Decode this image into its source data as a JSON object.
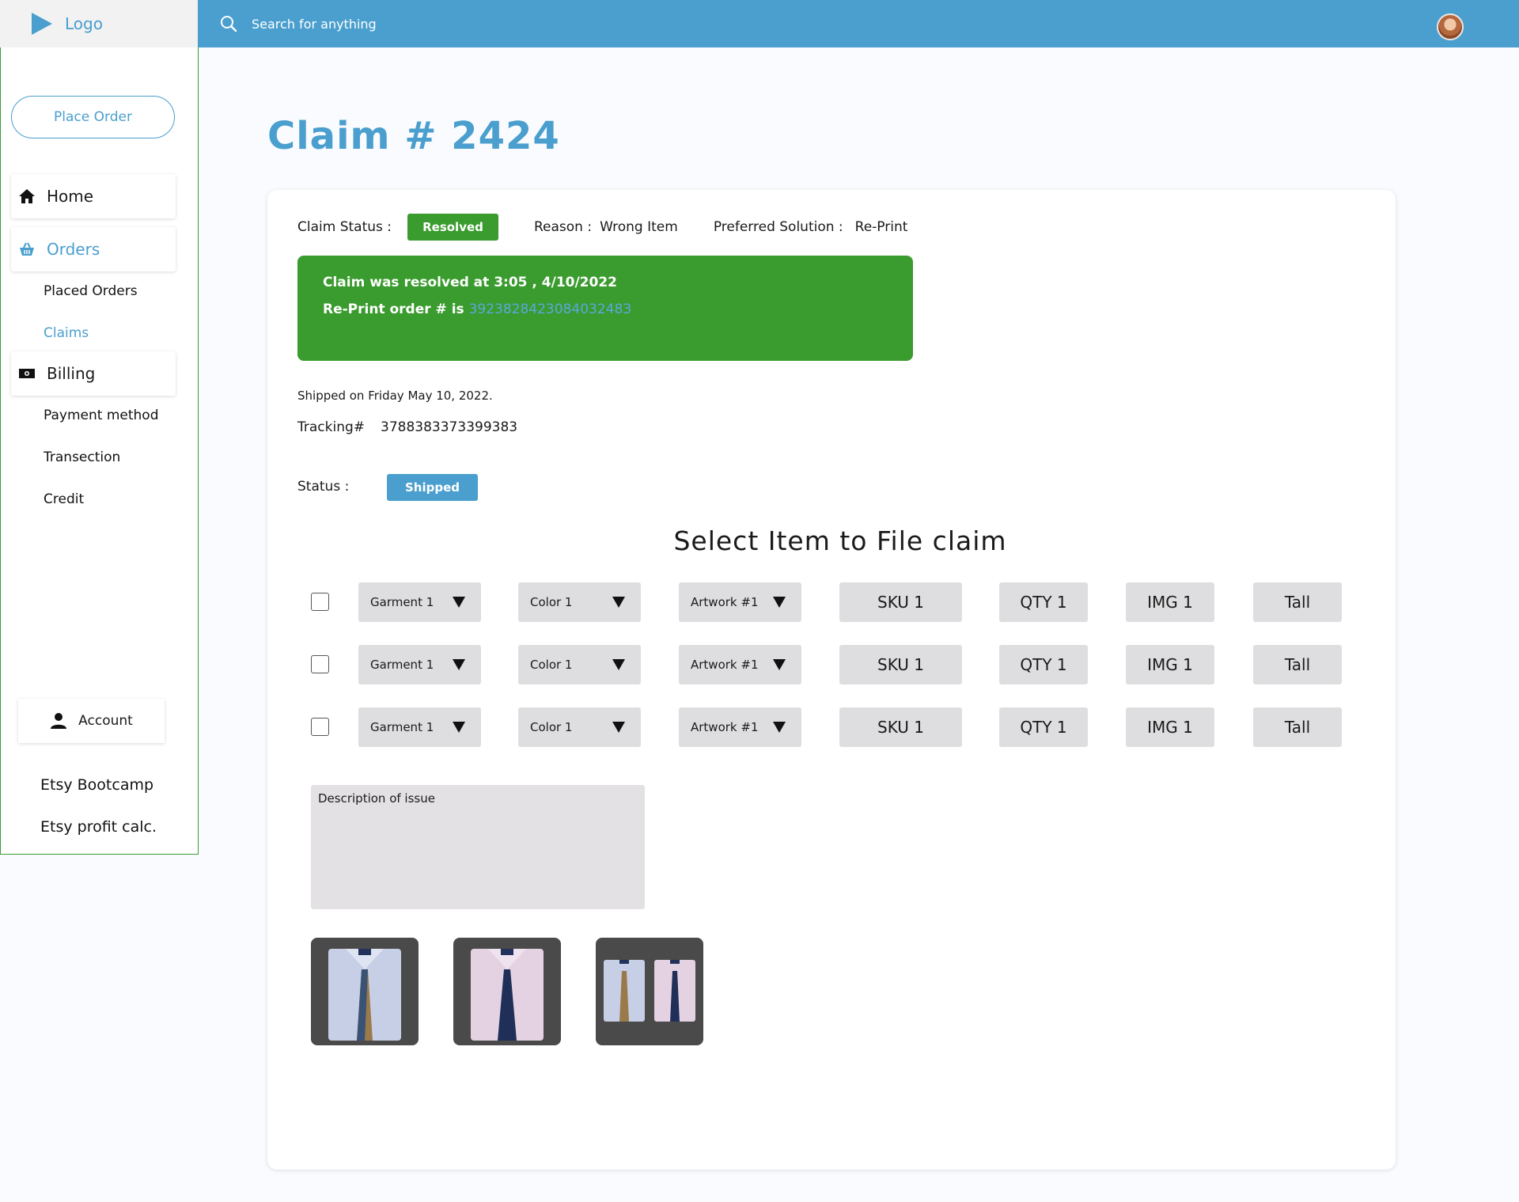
{
  "header": {
    "logo_text": "Logo",
    "search_placeholder": "Search for anything"
  },
  "sidebar": {
    "place_order": "Place Order",
    "home": "Home",
    "orders": "Orders",
    "placed_orders": "Placed Orders",
    "claims": "Claims",
    "billing": "Billing",
    "payment_method": "Payment method",
    "transection": "Transection",
    "credit": "Credit",
    "account": "Account",
    "etsy_bootcamp": "Etsy Bootcamp",
    "etsy_profit": "Etsy profit calc."
  },
  "page": {
    "title": "Claim # 2424"
  },
  "claim": {
    "status_label": "Claim Status :",
    "status_value": "Resolved",
    "reason_label": "Reason :",
    "reason_value": "Wrong Item",
    "solution_label": "Preferred Solution :",
    "solution_value": "Re-Print",
    "resolved_message": "Claim was resolved at 3:05 , 4/10/2022",
    "reprint_label": "Re-Print order # is ",
    "reprint_order": "392382842308403248З"
  },
  "shipping": {
    "shipped_on": "Shipped on Friday May 10, 2022.",
    "tracking_label": "Tracking#",
    "tracking_value": "3788383373399383",
    "status_label": "Status :",
    "status_value": "Shipped"
  },
  "items": {
    "section_title": "Select Item to File claim",
    "rows": [
      {
        "garment": "Garment 1",
        "color": "Color 1",
        "artwork": "Artwork #1",
        "sku": "SKU 1",
        "qty": "QTY 1",
        "img": "IMG 1",
        "size": "Tall"
      },
      {
        "garment": "Garment 1",
        "color": "Color 1",
        "artwork": "Artwork #1",
        "sku": "SKU 1",
        "qty": "QTY 1",
        "img": "IMG 1",
        "size": "Tall"
      },
      {
        "garment": "Garment 1",
        "color": "Color 1",
        "artwork": "Artwork #1",
        "sku": "SKU 1",
        "qty": "QTY 1",
        "img": "IMG 1",
        "size": "Tall"
      }
    ]
  },
  "description": {
    "placeholder": "Description of issue"
  },
  "colors": {
    "brand_blue": "#4a9fce",
    "success_green": "#3a9b2e"
  },
  "icons": [
    "play-logo-icon",
    "search-icon",
    "home-icon",
    "basket-icon",
    "cash-icon",
    "user-icon"
  ]
}
